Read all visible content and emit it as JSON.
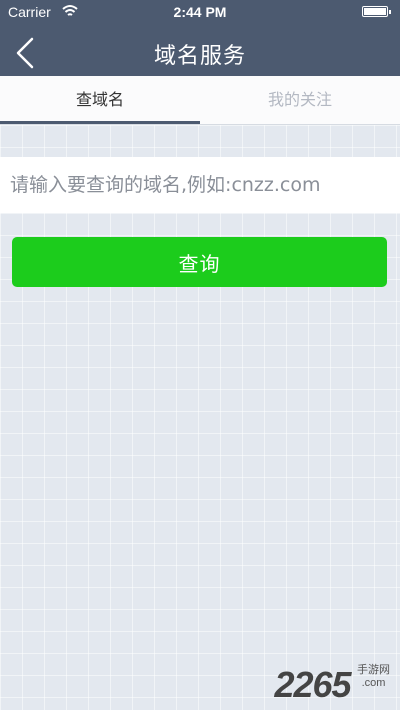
{
  "status_bar": {
    "carrier": "Carrier",
    "time": "2:44 PM"
  },
  "header": {
    "title": "域名服务",
    "back_icon": "chevron-left-icon"
  },
  "tabs": [
    {
      "label": "查域名",
      "active": true
    },
    {
      "label": "我的关注",
      "active": false
    }
  ],
  "search": {
    "placeholder": "请输入要查询的域名,例如:cnzz.com",
    "value": ""
  },
  "query_button": {
    "label": "查询"
  },
  "watermark": {
    "brand": "2265",
    "cn": "手游网",
    "domain": ".com"
  },
  "colors": {
    "header_bg": "#4c5a70",
    "button_green": "#1ccc1c",
    "page_bg": "#e3e8ef"
  }
}
